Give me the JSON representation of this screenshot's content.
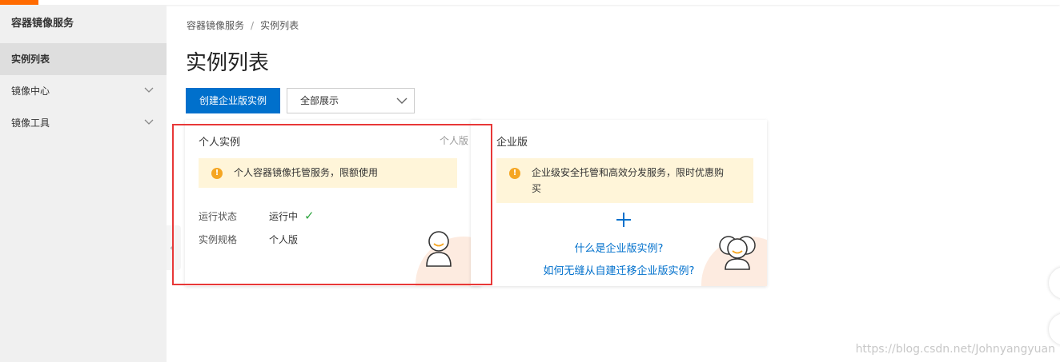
{
  "sidebar": {
    "title": "容器镜像服务",
    "items": [
      {
        "label": "实例列表",
        "active": true
      },
      {
        "label": "镜像中心",
        "expandable": true
      },
      {
        "label": "镜像工具",
        "expandable": true
      }
    ]
  },
  "breadcrumb": {
    "items": [
      "容器镜像服务",
      "实例列表"
    ],
    "separator": "/"
  },
  "page": {
    "title": "实例列表"
  },
  "toolbar": {
    "create_button": "创建企业版实例",
    "filter_select": {
      "value": "全部展示"
    }
  },
  "cards": {
    "personal": {
      "title": "个人实例",
      "tag": "个人版",
      "notice": "个人容器镜像托管服务，限额使用",
      "status_label": "运行状态",
      "status_value": "运行中",
      "spec_label": "实例规格",
      "spec_value": "个人版"
    },
    "enterprise": {
      "title": "企业版",
      "notice": "企业级安全托管和高效分发服务，限时优惠购买",
      "link_what": "什么是企业版实例?",
      "link_migrate": "如何无缝从自建迁移企业版实例?"
    }
  },
  "watermark": "https://blog.csdn.net/Johnyangyuan",
  "colors": {
    "accent": "#ff6a00",
    "primary": "#0070cc",
    "warning": "#f5a623",
    "success": "#2ea53f",
    "highlight": "#e83838"
  },
  "icons": [
    "chevron-down-icon",
    "warning-icon",
    "check-icon",
    "plus-icon",
    "avatar-icon",
    "collapse-arrow-icon"
  ]
}
